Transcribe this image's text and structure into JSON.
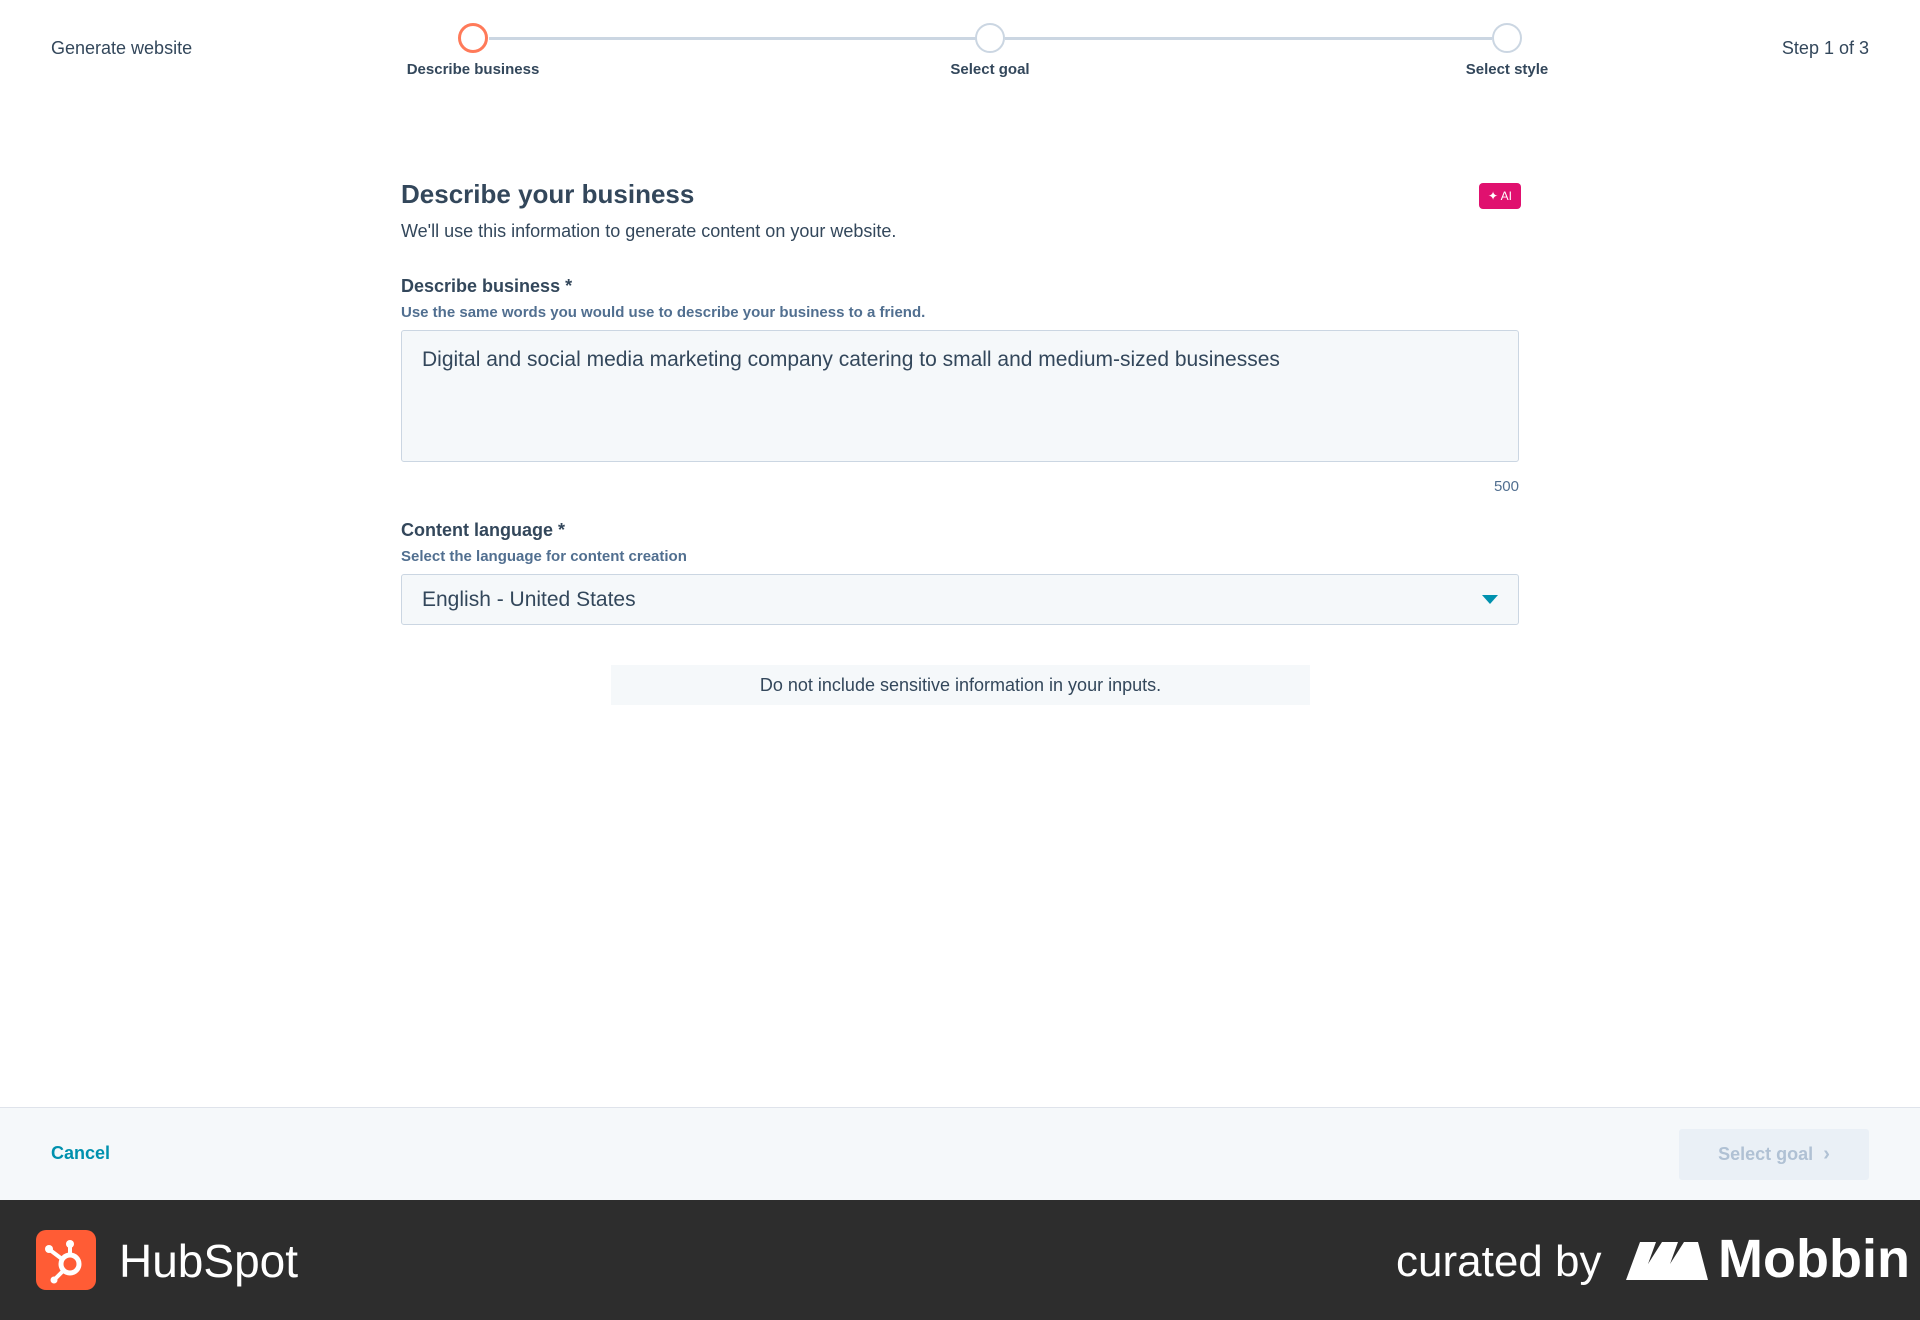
{
  "header": {
    "app_title": "Generate website",
    "step_counter": "Step 1 of 3",
    "steps": [
      {
        "label": "Describe business",
        "state": "active"
      },
      {
        "label": "Select goal",
        "state": "pending"
      },
      {
        "label": "Select style",
        "state": "pending"
      }
    ]
  },
  "form": {
    "title": "Describe your business",
    "ai_badge": "✦ AI",
    "subtitle": "We'll use this information to generate content on your website.",
    "business": {
      "label": "Describe business *",
      "help": "Use the same words you would use to describe your business to a friend.",
      "value": "Digital and social media marketing company catering to small and medium-sized businesses",
      "char_count": "500"
    },
    "language": {
      "label": "Content language *",
      "help": "Select the language for content creation",
      "selected": "English - United States"
    },
    "notice": "Do not include sensitive information in your inputs."
  },
  "footer": {
    "cancel_label": "Cancel",
    "next_label": "Select goal",
    "next_chevron": "›"
  },
  "branding": {
    "app_name": "HubSpot",
    "curated_by": "curated by",
    "curator": "Mobbin"
  },
  "colors": {
    "accent": "#0091ae",
    "active_step": "#ff7a59",
    "ai_badge": "#e0116f",
    "hubspot_orange": "#ff5c35"
  }
}
